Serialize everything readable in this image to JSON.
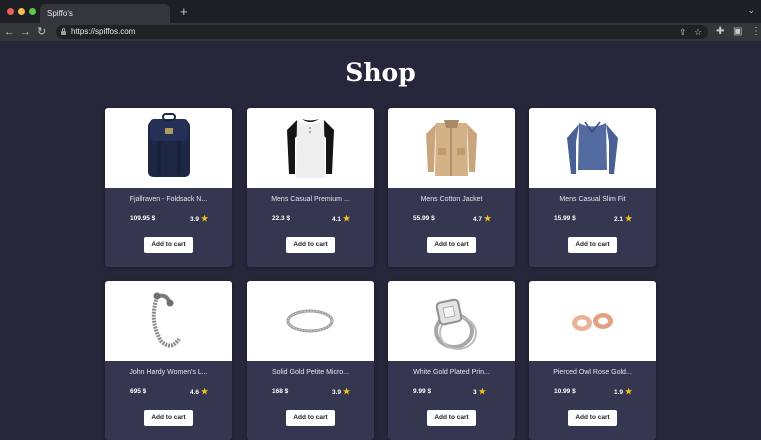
{
  "browser": {
    "tab_title": "Spiffo's",
    "new_tab": "+",
    "url": "https://spiffos.com"
  },
  "page": {
    "title": "Shop"
  },
  "products": [
    {
      "title": "Fjallraven - Foldsack N...",
      "price": "109.95 $",
      "rating": "3.9",
      "button": "Add to cart",
      "icon": "backpack-image"
    },
    {
      "title": "Mens Casual Premium ...",
      "price": "22.3 $",
      "rating": "4.1",
      "button": "Add to cart",
      "icon": "raglan-shirt-image"
    },
    {
      "title": "Mens Cotton Jacket",
      "price": "55.99 $",
      "rating": "4.7",
      "button": "Add to cart",
      "icon": "jacket-image"
    },
    {
      "title": "Mens Casual Slim Fit",
      "price": "15.99 $",
      "rating": "2.1",
      "button": "Add to cart",
      "icon": "long-sleeve-image"
    },
    {
      "title": "John Hardy Women's L...",
      "price": "695 $",
      "rating": "4.6",
      "button": "Add to cart",
      "icon": "bracelet-image"
    },
    {
      "title": "Solid Gold Petite Micro...",
      "price": "168 $",
      "rating": "3.9",
      "button": "Add to cart",
      "icon": "ring-band-image"
    },
    {
      "title": "White Gold Plated Prin...",
      "price": "9.99 $",
      "rating": "3",
      "button": "Add to cart",
      "icon": "diamond-ring-image"
    },
    {
      "title": "Pierced Owl Rose Gold...",
      "price": "10.99 $",
      "rating": "1.9",
      "button": "Add to cart",
      "icon": "earrings-image"
    }
  ],
  "colors": {
    "page_background": "#26273a",
    "card_background": "#353650",
    "star": "#f5c518"
  }
}
